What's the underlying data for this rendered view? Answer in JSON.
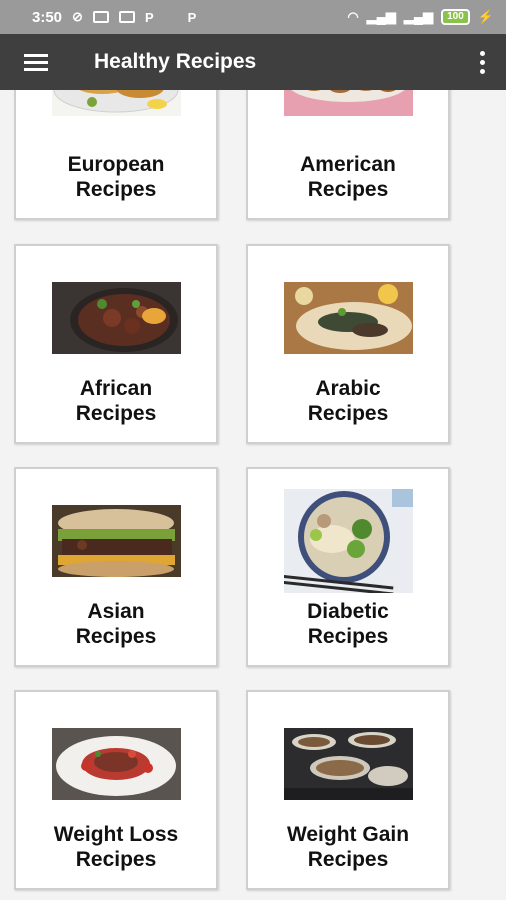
{
  "status_bar": {
    "time": "3:50",
    "left_icons": [
      "silent-icon",
      "camera-icon",
      "keyboard-icon",
      "p-icon",
      "p-icon"
    ],
    "battery": "100"
  },
  "app_bar": {
    "title": "Healthy Recipes"
  },
  "cards": [
    {
      "line1": "European",
      "line2": "Recipes",
      "image": "european-food-image"
    },
    {
      "line1": "American",
      "line2": "Recipes",
      "image": "american-food-image"
    },
    {
      "line1": "African",
      "line2": "Recipes",
      "image": "african-food-image"
    },
    {
      "line1": "Arabic",
      "line2": "Recipes",
      "image": "arabic-food-image"
    },
    {
      "line1": "Asian",
      "line2": "Recipes",
      "image": "asian-food-image"
    },
    {
      "line1": "Diabetic",
      "line2": "Recipes",
      "image": "diabetic-food-image"
    },
    {
      "line1": "Weight Loss",
      "line2": "Recipes",
      "image": "weight-loss-food-image"
    },
    {
      "line1": "Weight Gain",
      "line2": "Recipes",
      "image": "weight-gain-food-image"
    }
  ],
  "colors": {
    "status_bar": "#9a9a9a",
    "app_bar": "#3f3f3f",
    "background": "#f3f3f3",
    "battery": "#8bc34a"
  }
}
